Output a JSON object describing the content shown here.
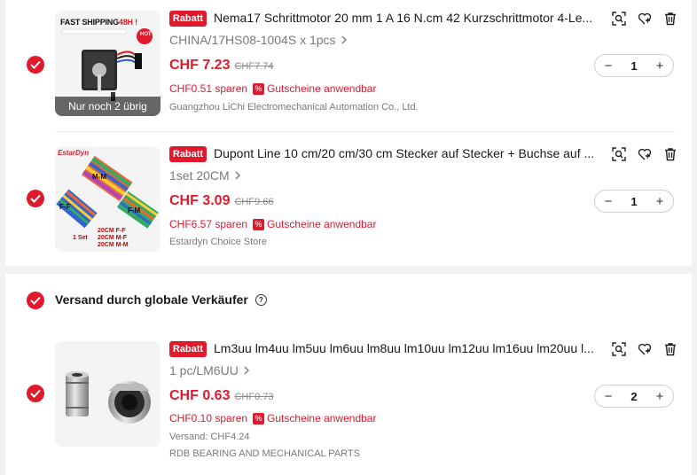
{
  "colors": {
    "accent": "#e0192d",
    "muted": "#7a7a7a"
  },
  "section": {
    "title": "Versand durch globale Verkäufer",
    "help_icon": "?"
  },
  "items": [
    {
      "badge": "Rabatt",
      "title": "Nema17 Schrittmotor 20 mm 1 A 16 N.cm 42 Kurzschrittmotor 4-Le...",
      "variant": "CHINA/17HS08-1004S x 1pcs",
      "price": "CHF 7.23",
      "old_price": "CHF7.74",
      "saving": "CHF0.51 sparen",
      "coupon": "Gutscheine anwendbar",
      "seller": "Guangzhou LiChi Electromechanical Automation Co., Ltd.",
      "quantity": "1",
      "stock_note": "Nur noch 2 übrig",
      "image_banner_a": "FAST SHIPPING",
      "image_banner_b": "48H !",
      "image_badge": "HOT",
      "checked": true
    },
    {
      "badge": "Rabatt",
      "title": "Dupont Line 10 cm/20 cm/30 cm Stecker auf Stecker + Buchse auf ...",
      "variant": "1set 20CM",
      "price": "CHF 3.09",
      "old_price": "CHF9.66",
      "saving": "CHF6.57 sparen",
      "coupon": "Gutscheine anwendbar",
      "seller": "Estardyn Choice Store",
      "quantity": "1",
      "image_brand": "EstarDyn",
      "image_labels": [
        "M-M",
        "F-F",
        "F-M"
      ],
      "image_set_lines": [
        "1 Set",
        "20CM  F-F",
        "20CM  M-F",
        "20CM  M-M"
      ],
      "checked": true
    },
    {
      "badge": "Rabatt",
      "title": "Lm3uu lm4uu lm5uu lm6uu lm8uu lm10uu lm12uu lm16uu lm20uu l...",
      "variant": "1 pc/LM6UU",
      "price": "CHF 0.63",
      "old_price": "CHF0.73",
      "saving": "CHF0.10 sparen",
      "coupon": "Gutscheine anwendbar",
      "shipping": "Versand: CHF4.24",
      "seller": "RDB BEARING AND MECHANICAL PARTS",
      "quantity": "2",
      "checked": true
    }
  ],
  "stepper": {
    "minus": "−",
    "plus": "+"
  },
  "icons": [
    "similar-search-icon",
    "wishlist-heart-icon",
    "delete-trash-icon",
    "chevron-right-icon",
    "checkmark-icon",
    "help-icon",
    "coupon-percent-icon"
  ]
}
